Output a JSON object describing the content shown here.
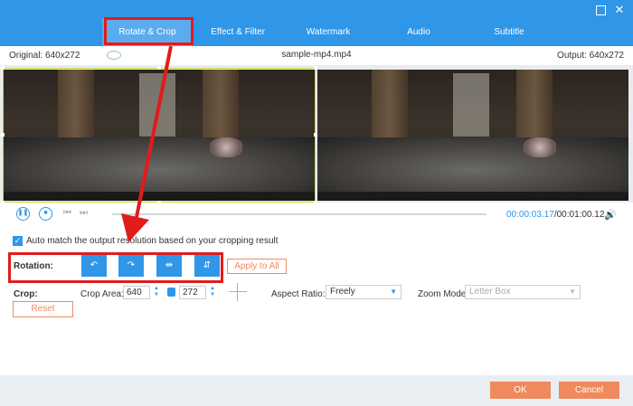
{
  "tabs": [
    {
      "label": "Rotate & Crop",
      "active": true
    },
    {
      "label": "Effect & Filter"
    },
    {
      "label": "Watermark"
    },
    {
      "label": "Audio"
    },
    {
      "label": "Subtitle"
    }
  ],
  "window": {
    "maximize_icon": "maximize-icon",
    "close_label": "✕"
  },
  "info": {
    "original": "Original: 640x272",
    "filename": "sample-mp4.mp4",
    "output": "Output: 640x272"
  },
  "playback": {
    "current_time": "00:00:03.17",
    "total_time": "/00:01:00.12",
    "progress": 0.05
  },
  "auto_match": {
    "checked": true,
    "label": "Auto match the output resolution based on your cropping result"
  },
  "rotation": {
    "label": "Rotation:",
    "buttons": [
      {
        "name": "rotate-left-icon",
        "glyph": "↶"
      },
      {
        "name": "rotate-right-icon",
        "glyph": "↷"
      },
      {
        "name": "flip-horizontal-icon",
        "glyph": "⇹"
      },
      {
        "name": "flip-vertical-icon",
        "glyph": "⇵"
      }
    ],
    "apply_label": "Apply to All"
  },
  "crop": {
    "label": "Crop:",
    "area_label": "Crop Area:",
    "width": "640",
    "height": "272",
    "aspect_label": "Aspect Ratio:",
    "aspect_value": "Freely",
    "zoom_label": "Zoom Mode:",
    "zoom_value": "Letter Box",
    "reset_label": "Reset"
  },
  "footer": {
    "ok_label": "OK",
    "cancel_label": "Cancel"
  },
  "colors": {
    "accent": "#2f96e8",
    "orange": "#f08a5d",
    "annotation": "#e21b1b"
  }
}
